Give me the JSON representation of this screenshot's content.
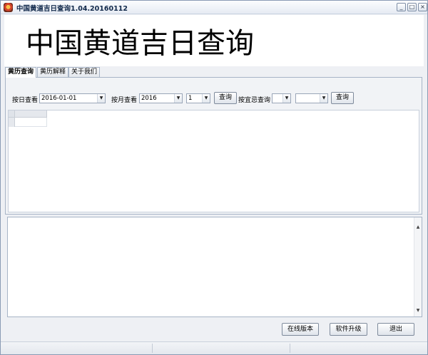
{
  "window": {
    "title": "中国黄道吉日查询1.04.20160112",
    "minimize_glyph": "_",
    "maximize_glyph": "□",
    "close_glyph": "×"
  },
  "banner": {
    "title": "中国黄道吉日查询"
  },
  "tabs": [
    {
      "label": "黄历查询",
      "active": true
    },
    {
      "label": "黄历解释",
      "active": false
    },
    {
      "label": "关于我们",
      "active": false
    }
  ],
  "query": {
    "by_day_label": "按日查看",
    "date_value": "2016-01-01",
    "by_month_label": "按月查看",
    "year_value": "2016",
    "month_value": "1",
    "query_button": "查询",
    "by_yiji_label": "按宜忌查询",
    "yiji_value_1": "",
    "yiji_value_2": "",
    "query_button_2": "查询"
  },
  "footer": {
    "online_version_button": "在线版本",
    "upgrade_button": "软件升级",
    "exit_button": "退出"
  },
  "icons": {
    "app": "app-logo-icon",
    "dropdown": "chevron-down-icon",
    "scroll_up": "scroll-up-icon",
    "scroll_down": "scroll-down-icon"
  },
  "colors": {
    "window_bg": "#eef0f4",
    "border": "#a7b4c6",
    "title_text": "#10284a"
  }
}
